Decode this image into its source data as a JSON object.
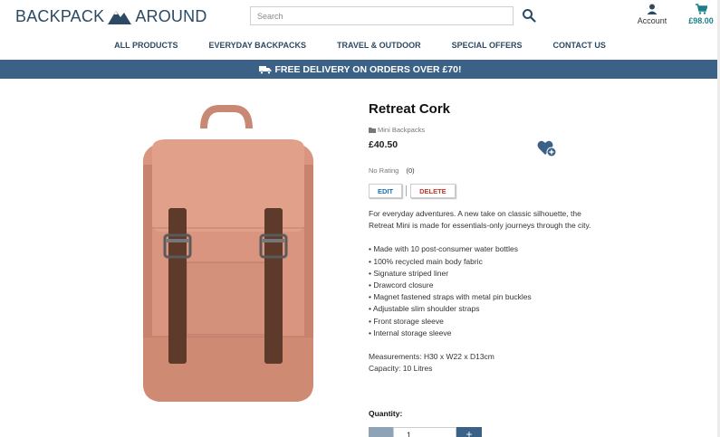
{
  "brand": {
    "left": "BACKPACK",
    "right": "AROUND",
    "color": "#2c4a63"
  },
  "search": {
    "placeholder": "Search",
    "icon": "search-icon"
  },
  "account": {
    "label": "Account",
    "icon": "user-icon"
  },
  "cart": {
    "total": "£98.00",
    "icon": "cart-icon",
    "color": "#1a7f8a"
  },
  "nav": [
    {
      "label": "ALL PRODUCTS"
    },
    {
      "label": "EVERYDAY BACKPACKS"
    },
    {
      "label": "TRAVEL & OUTDOOR"
    },
    {
      "label": "SPECIAL OFFERS"
    },
    {
      "label": "CONTACT US"
    }
  ],
  "banner": {
    "text": "FREE DELIVERY ON ORDERS OVER £70!",
    "icon": "truck-icon",
    "color": "#3b6286"
  },
  "product": {
    "title": "Retreat Cork",
    "category": "Mini Backpacks",
    "category_icon": "tag-icon",
    "price": "£40.50",
    "wishlist_icon": "heart-plus-icon",
    "rating_text": "No Rating",
    "rating_count": "(0)",
    "edit_label": "EDIT",
    "delete_label": "DELETE",
    "description": "For everyday adventures. A new take on classic silhouette, the Retreat Mini is made for essentials-only journeys through the city.",
    "features": [
      "• Made with 10 post-consumer water bottles",
      "• 100% recycled main body fabric",
      "• Signature striped liner",
      "• Drawcord closure",
      "• Magnet fastened straps with metal pin buckles",
      "• Adjustable slim shoulder straps",
      "• Front storage sleeve",
      "• Internal storage sleeve"
    ],
    "measurements": "Measurements: H30 x W22 x D13cm",
    "capacity": "Capacity: 10 Litres",
    "quantity_label": "Quantity:",
    "quantity_value": "1",
    "plus_label": "+"
  }
}
